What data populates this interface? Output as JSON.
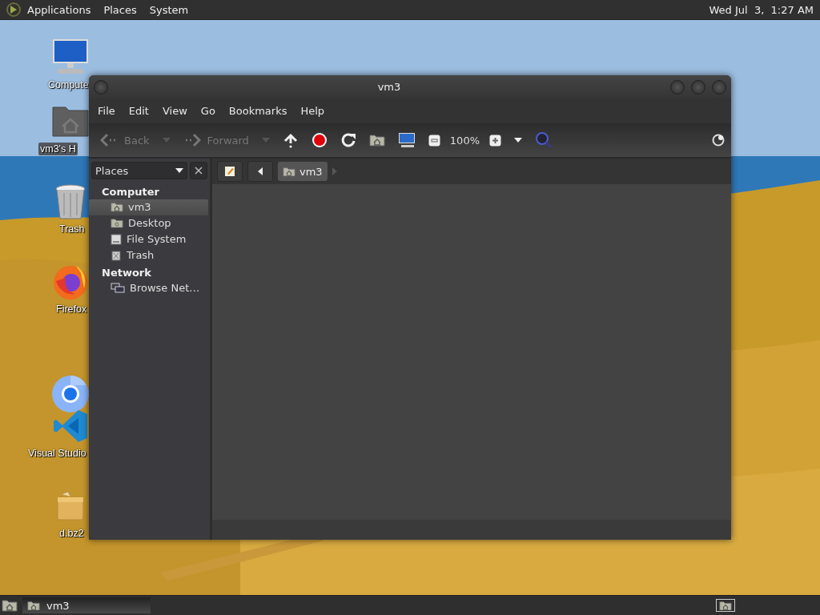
{
  "top_panel": {
    "menus": [
      "Applications",
      "Places",
      "System"
    ],
    "clock": "Wed Jul  3,  1:27 AM"
  },
  "desktop": {
    "icons": [
      {
        "kind": "computer",
        "label": "Compute",
        "selected": false
      },
      {
        "kind": "home-folder",
        "label": "vm3's H",
        "selected": true
      },
      {
        "kind": "trash",
        "label": "Trash",
        "selected": false
      },
      {
        "kind": "firefox",
        "label": "Firefox",
        "selected": false
      },
      {
        "kind": "chromium",
        "selected": false
      },
      {
        "kind": "vscode",
        "label": "Visual Studio",
        "selected": false
      },
      {
        "kind": "archive",
        "label": "d.bz2",
        "selected": false
      }
    ]
  },
  "window": {
    "title": "vm3",
    "menus": [
      "File",
      "Edit",
      "View",
      "Go",
      "Bookmarks",
      "Help"
    ],
    "toolbar": {
      "back": {
        "label": "Back",
        "disabled": true
      },
      "forward": {
        "label": "Forward",
        "disabled": true
      },
      "zoom": "100%"
    },
    "sidebar": {
      "selector": "Places",
      "sections": [
        {
          "heading": "Computer",
          "items": [
            {
              "kind": "home",
              "label": "vm3",
              "selected": true
            },
            {
              "kind": "desktop",
              "label": "Desktop",
              "selected": false
            },
            {
              "kind": "drive",
              "label": "File System",
              "selected": false
            },
            {
              "kind": "trash",
              "label": "Trash",
              "selected": false
            }
          ]
        },
        {
          "heading": "Network",
          "items": [
            {
              "kind": "network",
              "label": "Browse Net…",
              "selected": false
            }
          ]
        }
      ]
    },
    "location": {
      "crumbs": [
        {
          "label": "vm3",
          "selected": true
        }
      ]
    }
  },
  "taskbar": {
    "items": [
      {
        "label": "vm3",
        "selected": true
      }
    ]
  }
}
